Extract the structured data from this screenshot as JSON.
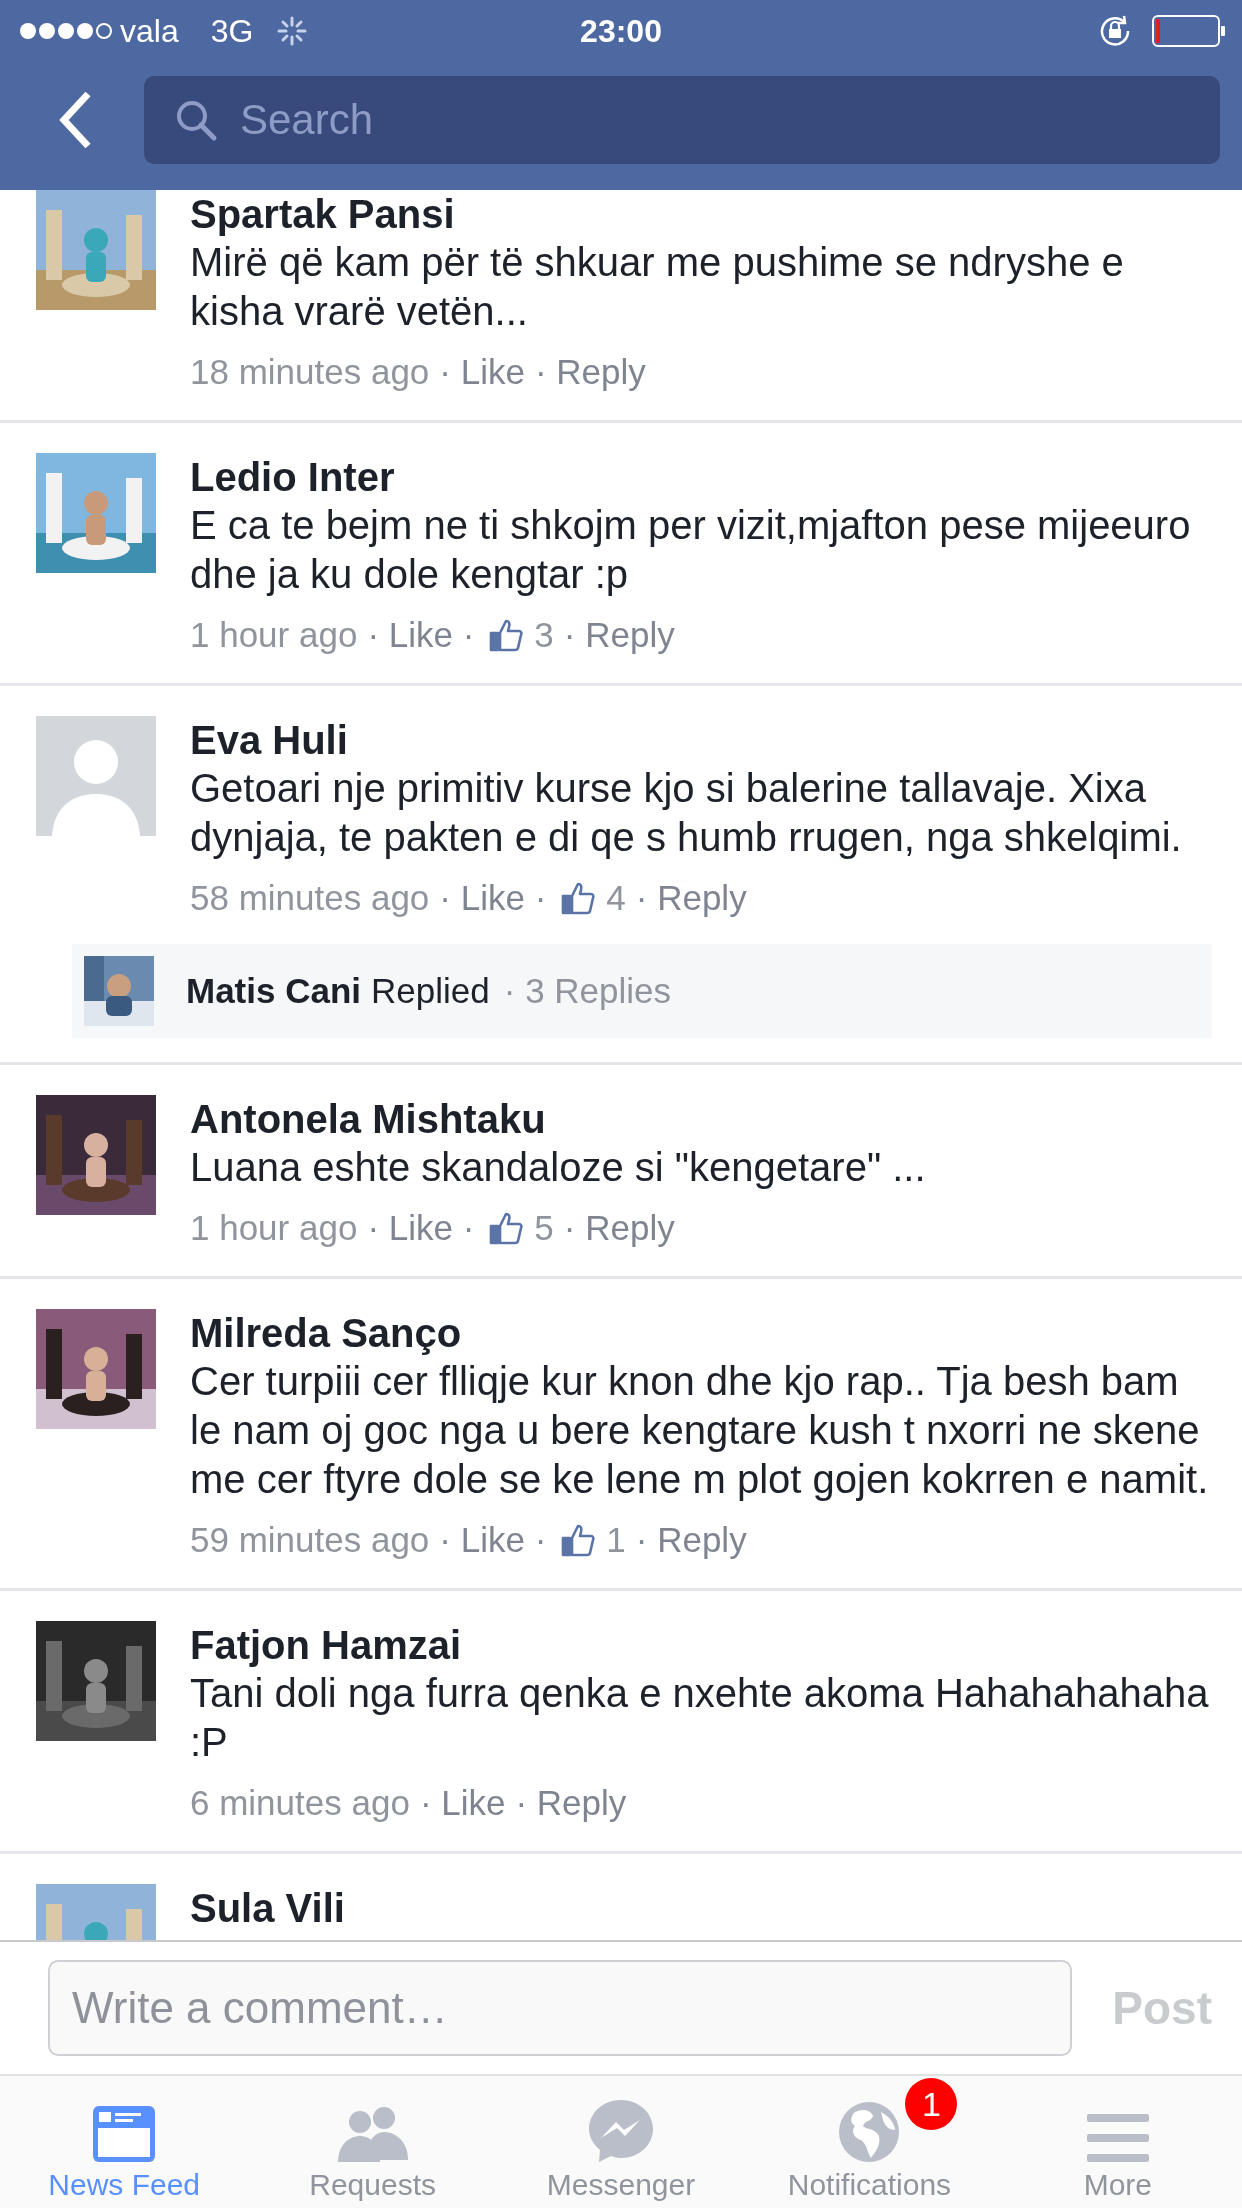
{
  "status_bar": {
    "carrier": "vala",
    "network": "3G",
    "time": "23:00"
  },
  "nav_bar": {
    "search": {
      "placeholder": "Search"
    }
  },
  "comments": [
    {
      "name": "Spartak Pansi",
      "text": "Mirë që kam për të shkuar me pushime se ndryshe e kisha vrarë vetën...",
      "time": "18 minutes ago",
      "like": "· Like",
      "reply": "· Reply"
    },
    {
      "name": "Ledio Inter",
      "text": "E ca te bejm ne ti shkojm per vizit,mjafton pese mijeeuro dhe ja ku dole kengtar :p",
      "time": "1 hour ago",
      "like": "· Like ·",
      "likes": "3",
      "reply": "· Reply"
    },
    {
      "name": "Eva Huli",
      "avatar": {
        "kind": "silhouette"
      },
      "text": "Getoari nje primitiv kurse kjo si balerine tallavaje. Xixa dynjaja, te pakten e di qe s humb rrugen, nga shkelqimi.",
      "time": "58 minutes ago",
      "like": "· Like ·",
      "likes": "4",
      "reply": "· Reply",
      "replies": {
        "name": "Matis Cani",
        "action": "Replied",
        "count": "· 3 Replies"
      }
    },
    {
      "name": "Antonela Mishtaku",
      "text": "Luana eshte skandaloze si \"kengetare\" ...",
      "time": "1 hour ago",
      "like": "· Like ·",
      "likes": "5",
      "reply": "· Reply"
    },
    {
      "name": "Milreda Sanço",
      "text": "Cer turpiii cer flliqje kur knon dhe kjo rap.. Tja besh bam le nam oj goc nga u bere kengtare kush t nxorri ne skene me cer ftyre dole se ke lene m plot gojen kokrren e namit.",
      "time": "59 minutes ago",
      "like": "· Like ·",
      "likes": "1",
      "reply": "· Reply"
    },
    {
      "name": "Fatjon Hamzai",
      "text": "Tani doli nga furra qenka e nxehte akoma Hahahahahaha :P",
      "time": "6 minutes ago",
      "like": "· Like",
      "reply": "· Reply"
    },
    {
      "name": "Sula Vili"
    }
  ],
  "composer": {
    "placeholder": "Write a comment…",
    "post": "Post"
  },
  "tab_bar": [
    {
      "kind": "feed",
      "label": "News Feed",
      "selected": true
    },
    {
      "kind": "requests",
      "label": "Requests",
      "selected": false
    },
    {
      "kind": "messenger",
      "label": "Messenger",
      "selected": false
    },
    {
      "kind": "notifications",
      "label": "Notifications",
      "selected": false,
      "badge": "1"
    },
    {
      "kind": "more",
      "label": "More",
      "selected": false
    }
  ]
}
